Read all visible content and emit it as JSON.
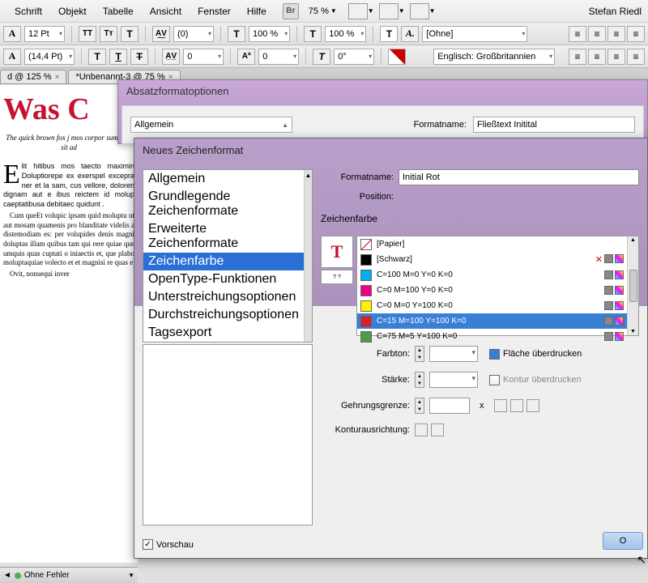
{
  "menubar": {
    "items": [
      "Schrift",
      "Objekt",
      "Tabelle",
      "Ansicht",
      "Fenster",
      "Hilfe"
    ],
    "icon_label": "Br",
    "zoom": "75 %",
    "user": "Stefan Riedl"
  },
  "toolbar1": {
    "size1": "12 Pt",
    "size2": "(14,4 Pt)",
    "scale": "(0)",
    "percent1": "100 %",
    "percent2": "100 %",
    "style": "[Ohne]"
  },
  "toolbar2": {
    "kern": "0",
    "spacing": "0",
    "angle": "0°",
    "lang": "Englisch: Großbritannien"
  },
  "tabs": [
    {
      "label": "d @ 125 %"
    },
    {
      "label": "*Unbenannt-3 @ 75 %"
    }
  ],
  "document": {
    "title": "Was C",
    "subtitle": "The quick brown fox j mos corpor sumquos sit ad",
    "dropcap": "E",
    "para1": "lit hitibus mos taecto maximin Doluptiorepe ex exerspel excepra ner et la sam, cus vellore, doloren dignam aut e ibus reictem id molup caeptatibusa debitaec quidunt .",
    "para2": "Cum queEt volupic ipsam quid moluptu ut aut mosam quamenis pro blanditate videlis a distemodiam es: per volupides denis magni doluptas illam quibus tam qui rere quiae que umquis quas cuptati o iniaectis et, que plabo moluptaquiae volecto et et magnisi re quas e",
    "para3": "Ovit, nonsequi inver"
  },
  "dialog1": {
    "title": "Absatzformatoptionen",
    "category": "Allgemein",
    "formatname_label": "Formatname:",
    "formatname": "Fließtext Initital"
  },
  "dialog2": {
    "title": "Neues Zeichenformat",
    "sidebar": {
      "items": [
        "Allgemein",
        "Grundlegende Zeichenformate",
        "Erweiterte Zeichenformate",
        "Zeichenfarbe",
        "OpenType-Funktionen",
        "Unterstreichungsoptionen",
        "Durchstreichungsoptionen",
        "Tagsexport"
      ],
      "selected": 3
    },
    "formatname_label": "Formatname:",
    "formatname": "Initial Rot",
    "position_label": "Position:",
    "section_title": "Zeichenfarbe",
    "swatches": [
      {
        "name": "[Papier]",
        "color": "white"
      },
      {
        "name": "[Schwarz]",
        "color": "black"
      },
      {
        "name": "C=100 M=0 Y=0 K=0",
        "color": "cyan"
      },
      {
        "name": "C=0 M=100 Y=0 K=0",
        "color": "magenta"
      },
      {
        "name": "C=0 M=0 Y=100 K=0",
        "color": "yellow"
      },
      {
        "name": "C=15 M=100 Y=100 K=0",
        "color": "red"
      },
      {
        "name": "C=75 M=5 Y=100 K=0",
        "color": "green"
      }
    ],
    "selected_swatch": 5,
    "tint_label": "Farbton:",
    "overprint_fill": "Fläche überdrucken",
    "stroke_label": "Stärke:",
    "overprint_stroke": "Kontur überdrucken",
    "miter_label": "Gehrungsgrenze:",
    "miter_unit": "x",
    "align_label": "Konturausrichtung:",
    "preview_label": "Vorschau",
    "ok_label": "O"
  },
  "statusbar": {
    "errors": "Ohne Fehler"
  }
}
